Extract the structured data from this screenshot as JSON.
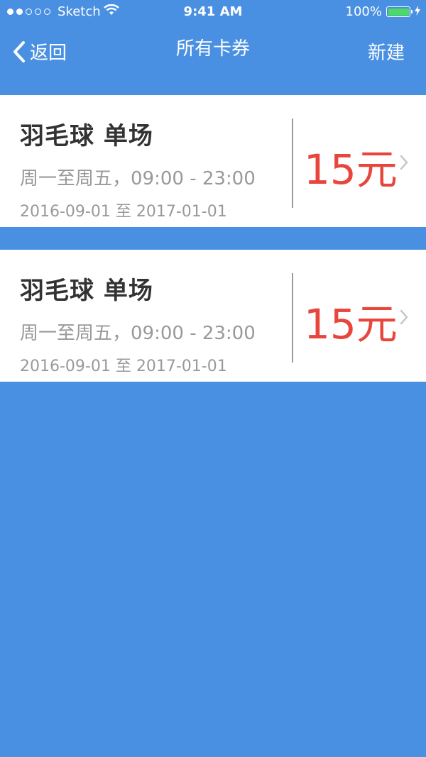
{
  "status_bar": {
    "carrier": "Sketch",
    "time": "9:41 AM",
    "battery_percent": "100%",
    "signal_bars_filled": 2,
    "signal_bars_total": 5
  },
  "nav": {
    "back_label": "返回",
    "title": "所有卡券",
    "new_label": "新建"
  },
  "cards": [
    {
      "name": "羽毛球 单场",
      "time": "周一至周五，09:00 - 23:00",
      "date_range": "2016-09-01 至 2017-01-01",
      "price": "15元"
    },
    {
      "name": "羽毛球 单场",
      "time": "周一至周五，09:00 - 23:00",
      "date_range": "2016-09-01 至 2017-01-01",
      "price": "15元"
    }
  ],
  "colors": {
    "background": "#4a90e2",
    "price": "#e8453c",
    "battery": "#4cd964"
  }
}
